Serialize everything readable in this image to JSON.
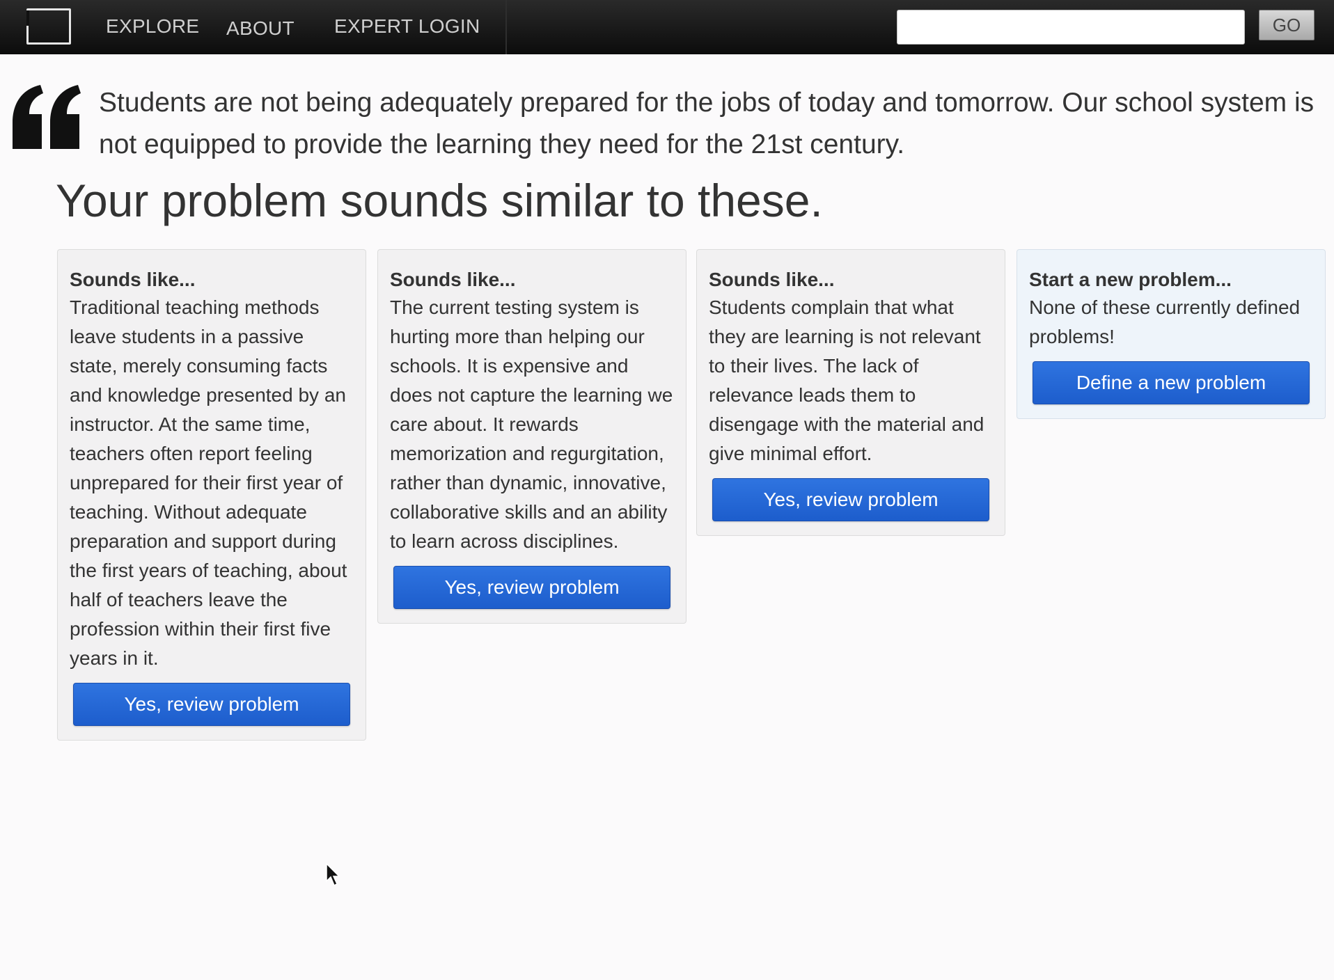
{
  "nav": {
    "items": [
      {
        "label": "EXPLORE"
      },
      {
        "label": "ABOUT"
      },
      {
        "label": "EXPERT LOGIN"
      }
    ],
    "search": {
      "value": "",
      "placeholder": ""
    },
    "go_label": "GO"
  },
  "quote": {
    "text": "Students are not being adequately prepared for the jobs of today and tomorrow. Our school system is not equipped to provide the learning they need for the 21st century."
  },
  "page_title": "Your problem sounds similar to these.",
  "cards": [
    {
      "heading": "Sounds like...",
      "text": "Traditional teaching methods leave students in a passive state, merely consuming facts and knowledge presented by an instructor. At the same time, teachers often report feeling unprepared for their first year of teaching. Without adequate preparation and support during the first years of teaching, about half of teachers leave the profession within their first five years in it.",
      "button": "Yes, review problem"
    },
    {
      "heading": "Sounds like...",
      "text": "The current testing system is hurting more than helping our schools. It is expensive and does not capture the learning we care about. It rewards memorization and regurgitation, rather than dynamic, innovative, collaborative skills and an ability to learn across disciplines.",
      "button": "Yes, review problem"
    },
    {
      "heading": "Sounds like...",
      "text": "Students complain that what they are learning is not relevant to their lives. The lack of relevance leads them to disengage with the material and give minimal effort.",
      "button": "Yes, review problem"
    },
    {
      "heading": "Start a new problem...",
      "text": "None of these currently defined problems!",
      "button": "Define a new problem"
    }
  ],
  "colors": {
    "topbar": "#111111",
    "button_blue": "#2266d6",
    "card_bg": "#f2f1f2",
    "new_card_bg": "#eef4fa"
  },
  "icons": {
    "logo": "frame-logo-icon",
    "quote": "quote-mark-icon",
    "cursor": "mouse-pointer-icon"
  }
}
